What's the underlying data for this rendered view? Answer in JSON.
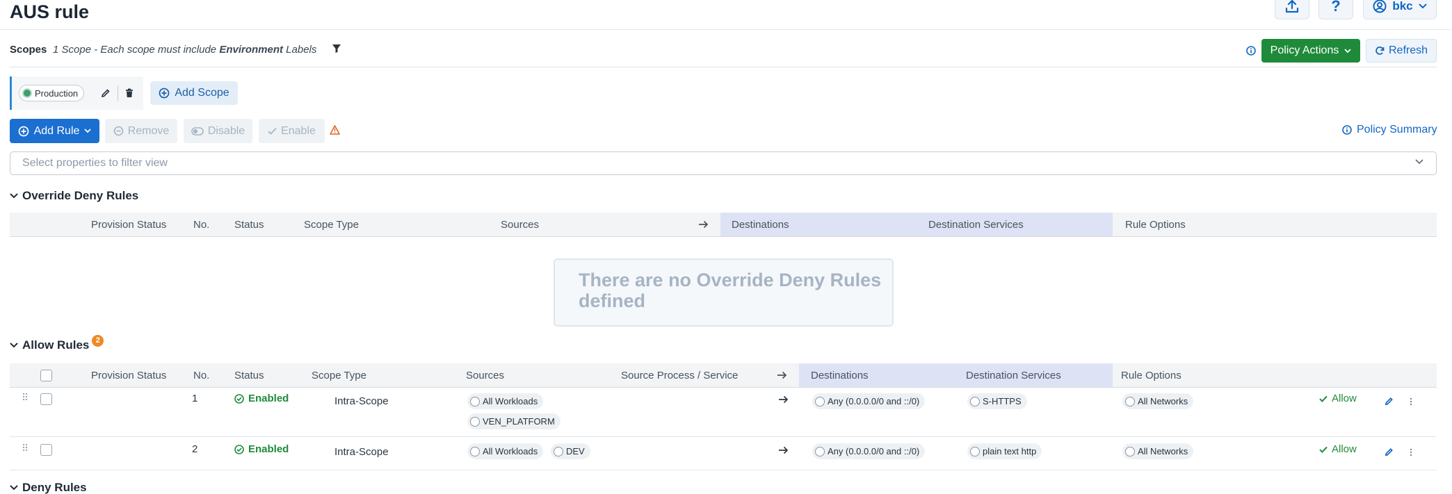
{
  "header": {
    "title": "AUS rule",
    "user": "bkc"
  },
  "scopes": {
    "label": "Scopes",
    "desc_prefix": "1 Scope - Each scope must include",
    "desc_bold": "Environment",
    "desc_suffix": "Labels",
    "chip": "Production",
    "add_scope": "Add Scope"
  },
  "actions": {
    "policy_actions": "Policy Actions",
    "refresh": "Refresh",
    "add_rule": "Add Rule",
    "remove": "Remove",
    "disable": "Disable",
    "enable": "Enable",
    "policy_summary": "Policy Summary",
    "filter_placeholder": "Select properties to filter view"
  },
  "override_deny": {
    "title": "Override Deny Rules",
    "columns": [
      "Provision Status",
      "No.",
      "Status",
      "Scope Type",
      "Sources",
      "Destinations",
      "Destination Services",
      "Rule Options"
    ],
    "empty_message": "There are no Override Deny Rules defined"
  },
  "allow_rules": {
    "title": "Allow Rules",
    "count": "2",
    "columns": [
      "Provision Status",
      "No.",
      "Status",
      "Scope Type",
      "Sources",
      "Source Process / Service",
      "Destinations",
      "Destination Services",
      "Rule Options"
    ],
    "rows": [
      {
        "no": "1",
        "status": "Enabled",
        "scope_type": "Intra-Scope",
        "sources": [
          "All Workloads",
          "VEN_PLATFORM"
        ],
        "destination": "Any (0.0.0.0/0 and ::/0)",
        "service": "S-HTTPS",
        "network": "All Networks",
        "action": "Allow"
      },
      {
        "no": "2",
        "status": "Enabled",
        "scope_type": "Intra-Scope",
        "sources": [
          "All Workloads",
          "DEV"
        ],
        "destination": "Any (0.0.0.0/0 and ::/0)",
        "service": "plain text http",
        "network": "All Networks",
        "action": "Allow"
      }
    ]
  },
  "deny_rules": {
    "title": "Deny Rules"
  }
}
